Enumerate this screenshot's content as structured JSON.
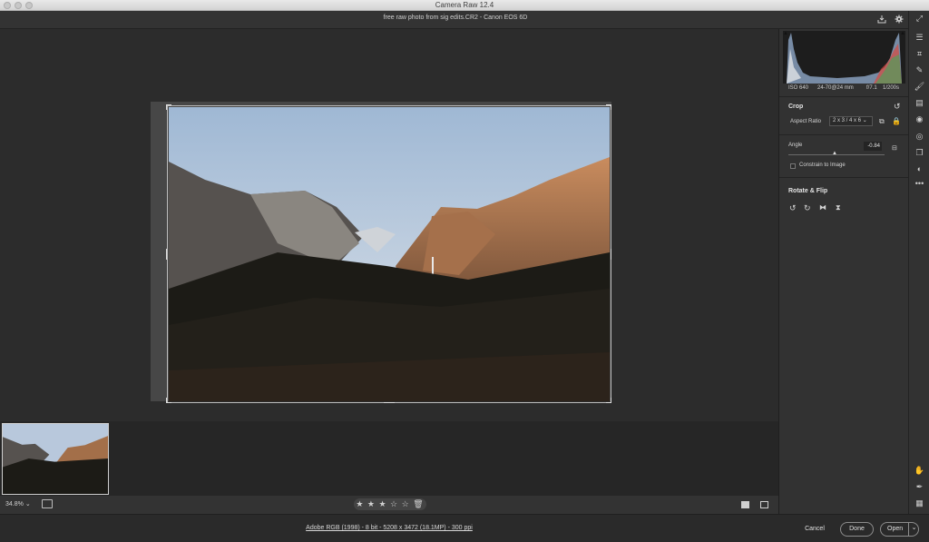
{
  "window": {
    "title": "Camera Raw 12.4"
  },
  "header": {
    "file_title": "free raw photo from sig edits.CR2  -  Canon EOS 6D",
    "save_icon": "download-icon",
    "settings_icon": "gear-icon"
  },
  "exif": {
    "iso": "ISO 640",
    "lens": "24-70@24 mm",
    "aperture": "f/7.1",
    "shutter": "1/200s"
  },
  "crop_panel": {
    "title": "Crop",
    "aspect_ratio_label": "Aspect Ratio",
    "aspect_ratio_value": "2 x 3 / 4 x 6",
    "angle_label": "Angle",
    "angle_value": "-0.84",
    "constrain_label": "Constrain to Image",
    "constrain_checked": false
  },
  "rotate_panel": {
    "title": "Rotate & Flip"
  },
  "statusbar": {
    "zoom": "34.8%",
    "stars": "★ ★ ★ ☆ ☆",
    "rating_value": 3
  },
  "footer": {
    "info": "Adobe RGB (1998) - 8 bit - 5208 x 3472 (18.1MP) - 300 ppi",
    "cancel": "Cancel",
    "done": "Done",
    "open": "Open"
  },
  "tools": [
    "expand-icon",
    "edit-sliders-icon",
    "crop-icon",
    "healing-icon",
    "brush-icon",
    "gradient-icon",
    "radial-icon",
    "redeye-icon",
    "snapshots-icon",
    "presets-icon",
    "more-icon",
    "hand-icon",
    "sampler-icon",
    "grid-icon"
  ],
  "colors": {
    "accent": "#d6d6d6",
    "panel_bg": "#323232",
    "canvas_bg": "#2c2c2c"
  }
}
